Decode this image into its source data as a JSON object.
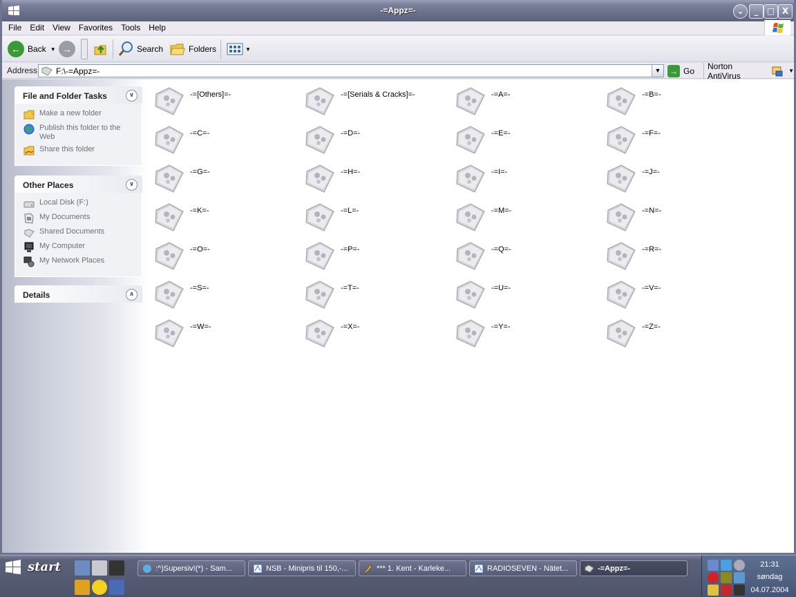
{
  "window": {
    "title": "-=Appz=-",
    "min_label": "_",
    "max_label": "□",
    "close_label": "X",
    "options_label": "⌄"
  },
  "menu": [
    {
      "label": "File"
    },
    {
      "label": "Edit"
    },
    {
      "label": "View"
    },
    {
      "label": "Favorites"
    },
    {
      "label": "Tools"
    },
    {
      "label": "Help"
    }
  ],
  "toolbar": {
    "back_label": "Back",
    "search_label": "Search",
    "folders_label": "Folders"
  },
  "address": {
    "label": "Address",
    "path": "F:\\-=Appz=-",
    "go_label": "Go",
    "norton_label": "Norton AntiVirus"
  },
  "taskpane": {
    "file_tasks": {
      "title": "File and Folder Tasks",
      "items": [
        {
          "label": "Make a new folder",
          "icon": "new-folder-icon"
        },
        {
          "label": "Publish this folder to the Web",
          "icon": "publish-web-icon"
        },
        {
          "label": "Share this folder",
          "icon": "share-folder-icon"
        }
      ]
    },
    "other_places": {
      "title": "Other Places",
      "items": [
        {
          "label": "Local Disk (F:)",
          "icon": "local-disk-icon"
        },
        {
          "label": "My Documents",
          "icon": "my-documents-icon"
        },
        {
          "label": "Shared Documents",
          "icon": "shared-documents-icon"
        },
        {
          "label": "My Computer",
          "icon": "my-computer-icon"
        },
        {
          "label": "My Network Places",
          "icon": "network-places-icon"
        }
      ]
    },
    "details": {
      "title": "Details"
    }
  },
  "folders": [
    "-=[Others]=-",
    "-=[Serials & Cracks]=-",
    "-=A=-",
    "-=B=-",
    "-=C=-",
    "-=D=-",
    "-=E=-",
    "-=F=-",
    "-=G=-",
    "-=H=-",
    "-=I=-",
    "-=J=-",
    "-=K=-",
    "-=L=-",
    "-=M=-",
    "-=N=-",
    "-=O=-",
    "-=P=-",
    "-=Q=-",
    "-=R=-",
    "-=S=-",
    "-=T=-",
    "-=U=-",
    "-=V=-",
    "-=W=-",
    "-=X=-",
    "-=Y=-",
    "-=Z=-"
  ],
  "taskbar": {
    "start_label": "start",
    "tasks": [
      {
        "label": ":^)Supersiv!(*) - Sam...",
        "active": false
      },
      {
        "label": "NSB - Minipris til 150,-...",
        "active": false
      },
      {
        "label": "*** 1. Kent  - Karleke...",
        "active": false
      },
      {
        "label": "RADIOSEVEN - Nätet...",
        "active": false
      },
      {
        "label": "-=Appz=-",
        "active": true
      }
    ],
    "clock": {
      "time": "21:31",
      "day": "søndag",
      "date": "04.07.2004"
    }
  },
  "colors": {
    "title_bar": "#6a6f8b",
    "taskbar": "#4e536c",
    "tray": "#465577",
    "link_gray": "#6d6f7a",
    "go_green": "#3a9a38"
  }
}
